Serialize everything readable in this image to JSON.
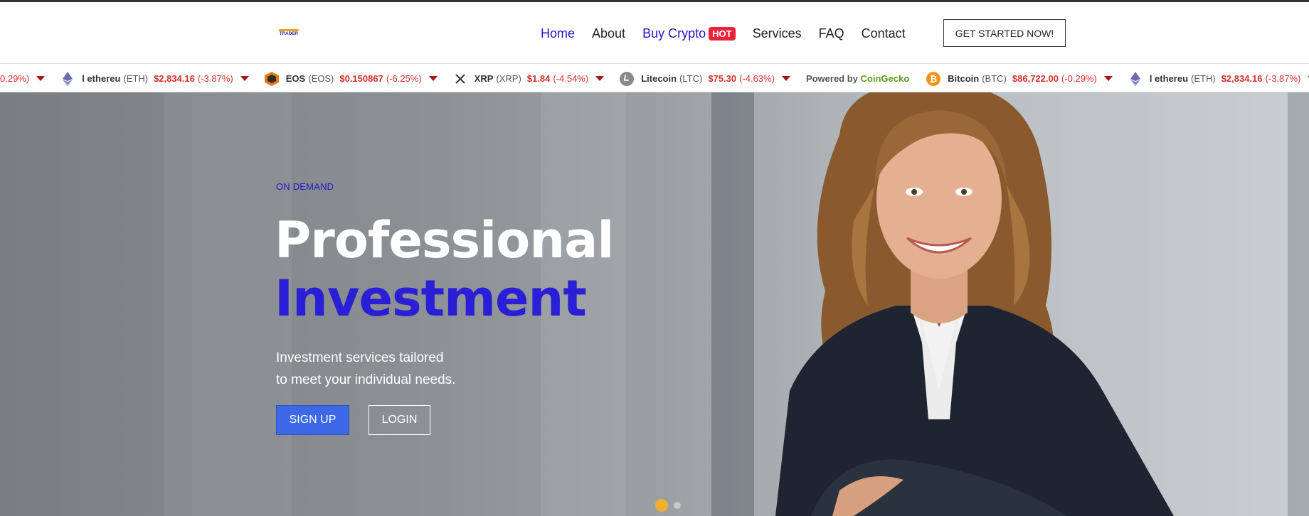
{
  "header": {
    "logo_text": "TRADER",
    "nav": [
      {
        "label": "Home"
      },
      {
        "label": "About"
      },
      {
        "label": "Buy Crypto",
        "badge": "HOT"
      },
      {
        "label": "Services"
      },
      {
        "label": "FAQ"
      },
      {
        "label": "Contact"
      }
    ],
    "cta_label": "GET STARTED NOW!"
  },
  "ticker": {
    "partial_change": "0.29%)",
    "coins": [
      {
        "name": "l ethereu",
        "symbol": "(ETH)",
        "price": "$2,834.16",
        "change": "(-3.87%)",
        "icon": "ethereum-icon"
      },
      {
        "name": "EOS",
        "symbol": "(EOS)",
        "price": "$0.150867",
        "change": "(-6.25%)",
        "icon": "eos-icon"
      },
      {
        "name": "XRP",
        "symbol": "(XRP)",
        "price": "$1.84",
        "change": "(-4.54%)",
        "icon": "xrp-icon"
      },
      {
        "name": "Litecoin",
        "symbol": "(LTC)",
        "price": "$75.30",
        "change": "(-4.63%)",
        "icon": "litecoin-icon"
      }
    ],
    "powered_prefix": "Powered by",
    "powered_brand": "CoinGecko",
    "coins_after": [
      {
        "name": "Bitcoin",
        "symbol": "(BTC)",
        "price": "$86,722.00",
        "change": "(-0.29%)",
        "icon": "bitcoin-icon"
      },
      {
        "name": "l ethereu",
        "symbol": "(ETH)",
        "price": "$2,834.16",
        "change": "(-3.87%)",
        "icon": "ethereum-icon"
      }
    ]
  },
  "hero": {
    "eyebrow": "ON DEMAND",
    "title_line1": "Professional",
    "title_line2": "Investment",
    "subtitle_line1": "Investment services tailored",
    "subtitle_line2": "to meet your individual needs.",
    "signup_label": "SIGN UP",
    "login_label": "LOGIN"
  },
  "colors": {
    "accent": "#2016c8",
    "hot": "#e8243c",
    "signup": "#3d68e8",
    "price_down": "#d9302a",
    "dot_active": "#f0b030"
  }
}
